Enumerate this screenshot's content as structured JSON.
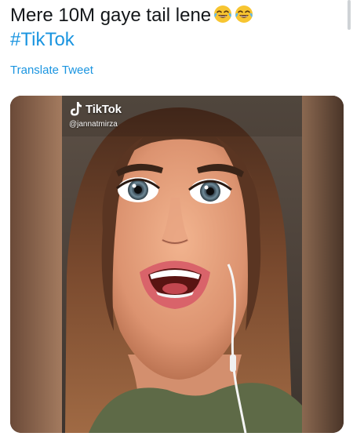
{
  "tweet": {
    "text_line1": "Mere 10M gaye tail lene",
    "emojis": [
      "face-with-tears-of-joy-icon",
      "face-with-tears-of-joy-icon"
    ],
    "hashtag": "#TikTok",
    "translate_label": "Translate Tweet"
  },
  "media": {
    "watermark_brand": "TikTok",
    "watermark_handle": "@jannatmirza",
    "watermark_icon": "tiktok-note-icon"
  },
  "colors": {
    "link": "#1b95e0",
    "text": "#14171a",
    "background": "#ffffff"
  }
}
